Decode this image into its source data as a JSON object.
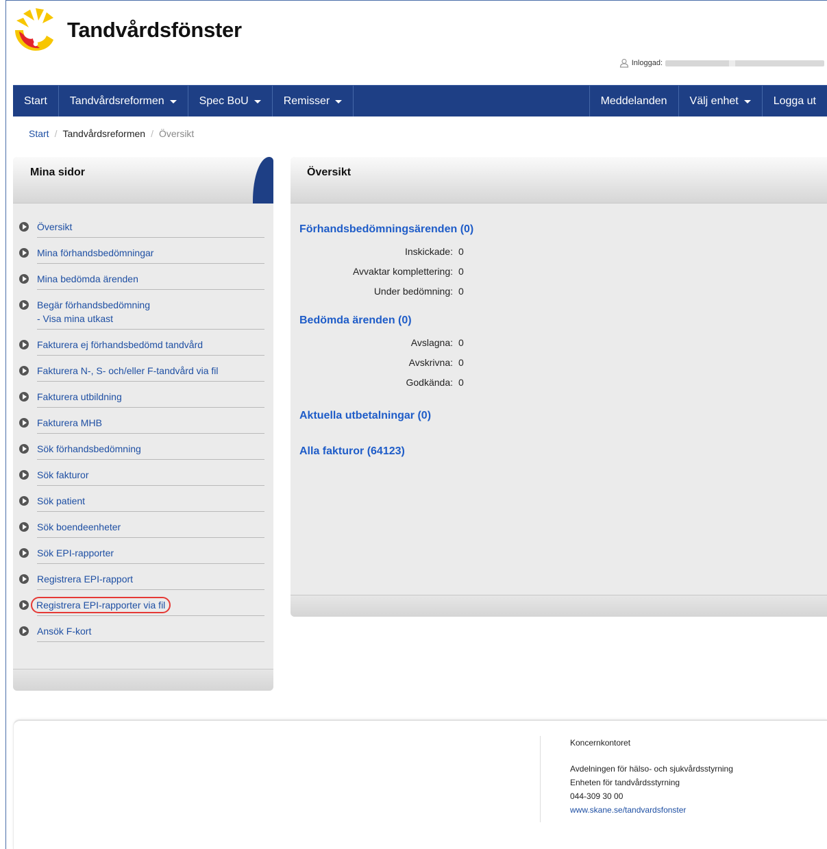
{
  "header": {
    "app_title": "Tandvårdsfönster",
    "logged_in_label": "Inloggad:"
  },
  "navbar": {
    "left": [
      "Start",
      "Tandvårdsreformen",
      "Spec BoU",
      "Remisser"
    ],
    "right": [
      "Meddelanden",
      "Välj enhet",
      "Logga ut"
    ]
  },
  "breadcrumb": {
    "items": [
      "Start",
      "Tandvårdsreformen",
      "Översikt"
    ],
    "separator": "/"
  },
  "sidebar": {
    "title": "Mina sidor",
    "items": [
      "Översikt",
      "Mina förhandsbedömningar",
      "Mina bedömda ärenden",
      "Begär förhandsbedömning",
      "Fakturera ej förhandsbedömd tandvård",
      "Fakturera N-, S- och/eller F-tandvård via fil",
      "Fakturera utbildning",
      "Fakturera MHB",
      "Sök förhandsbedömning",
      "Sök fakturor",
      "Sök patient",
      "Sök boendeenheter",
      "Sök EPI-rapporter",
      "Registrera EPI-rapport",
      "Registrera EPI-rapporter via fil",
      "Ansök F-kort"
    ],
    "sub_item": "- Visa mina utkast"
  },
  "overview": {
    "title": "Översikt",
    "sections": {
      "pre_assessment": {
        "title": "Förhandsbedömningsärenden (0)",
        "rows": [
          {
            "label": "Inskickade:",
            "value": "0"
          },
          {
            "label": "Avvaktar komplettering:",
            "value": "0"
          },
          {
            "label": "Under bedömning:",
            "value": "0"
          }
        ]
      },
      "assessed": {
        "title": "Bedömda ärenden (0)",
        "rows": [
          {
            "label": "Avslagna:",
            "value": "0"
          },
          {
            "label": "Avskrivna:",
            "value": "0"
          },
          {
            "label": "Godkända:",
            "value": "0"
          }
        ]
      },
      "payments": {
        "title": "Aktuella utbetalningar (0)"
      },
      "invoices": {
        "title": "Alla fakturor (64123)"
      }
    }
  },
  "footer": {
    "org": "Koncernkontoret",
    "dept": "Avdelningen för hälso- och sjukvårdsstyrning",
    "unit": "Enheten för tandvårdsstyrning",
    "phone": "044-309 30 00",
    "link": "www.skane.se/tandvardsfonster"
  },
  "colors": {
    "navbar": "#1e3f85",
    "link": "#1e4fa3",
    "section_title": "#1e5cc8",
    "highlight_circle": "#e53935"
  }
}
